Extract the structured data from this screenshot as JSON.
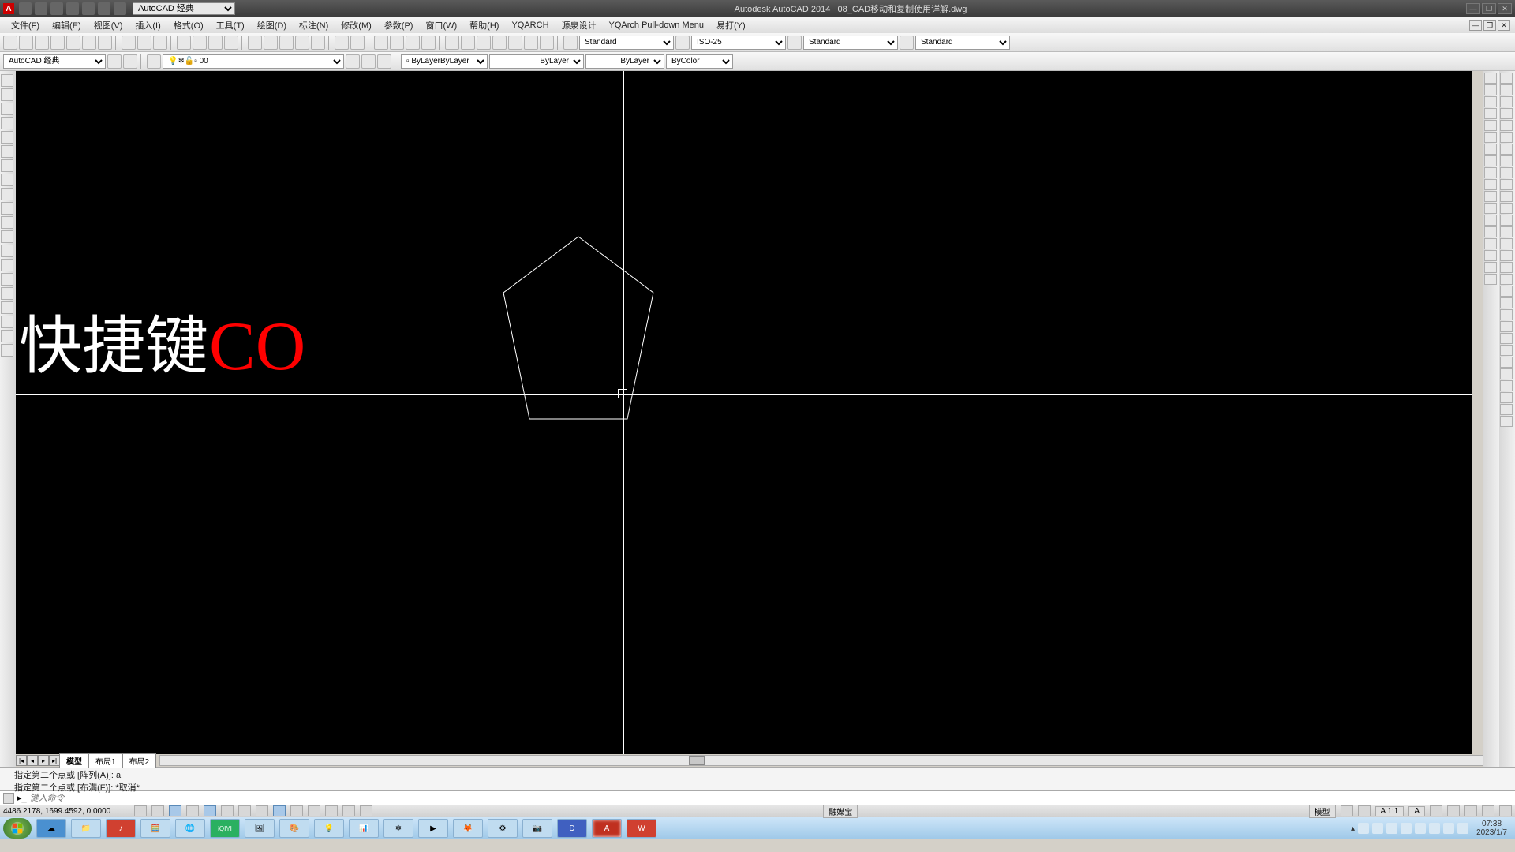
{
  "titlebar": {
    "app": "Autodesk AutoCAD 2014",
    "file": "08_CAD移动和复制使用详解.dwg",
    "workspace_selector": "AutoCAD 经典"
  },
  "menu": {
    "items": [
      "文件(F)",
      "编辑(E)",
      "视图(V)",
      "插入(I)",
      "格式(O)",
      "工具(T)",
      "绘图(D)",
      "标注(N)",
      "修改(M)",
      "参数(P)",
      "窗口(W)",
      "帮助(H)",
      "YQARCH",
      "源泉设计",
      "YQArch Pull-down Menu",
      "易打(Y)"
    ]
  },
  "toolbars": {
    "workspace": "AutoCAD 经典",
    "layer": "0",
    "text_style": "Standard",
    "dim_style": "ISO-25",
    "table_style": "Standard",
    "mleader_style": "Standard",
    "color": "ByLayer",
    "linetype": "ByLayer",
    "lineweight": "ByLayer",
    "plot_style": "ByColor"
  },
  "drawing": {
    "overlay_white": "快捷键",
    "overlay_red": "CO"
  },
  "tabs": {
    "model": "模型",
    "layout1": "布局1",
    "layout2": "布局2"
  },
  "command": {
    "hist1": "指定第二个点或 [阵列(A)]: a",
    "hist2": "指定第二个点或 [布满(F)]: *取消*",
    "placeholder": "键入命令"
  },
  "status": {
    "coords": "4486.2178, 1699.4592, 0.0000",
    "rongmeibao": "融媒宝",
    "model_btn": "模型",
    "scale": "A 1:1",
    "anno": "A"
  },
  "taskbar": {
    "time": "07:38",
    "date": "2023/1/7"
  }
}
